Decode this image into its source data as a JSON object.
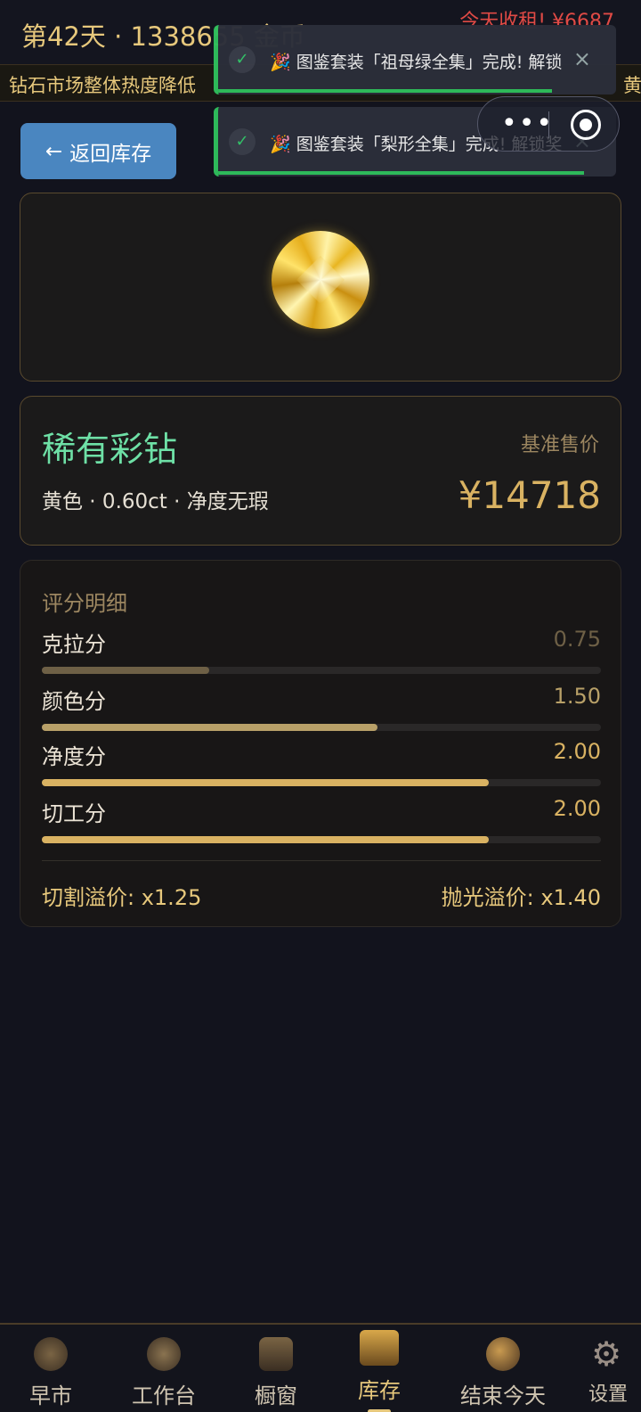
{
  "header": {
    "day_title": "第42天 · 1338655 金币",
    "rent_notice": "今天收租! ¥6687"
  },
  "ticker": {
    "text": "钻石市场整体热度降低",
    "text2": "黄"
  },
  "toasts": [
    {
      "message": "🎉 图鉴套装「祖母绿全集」完成! 解锁",
      "close": "×",
      "progress": 0.84
    },
    {
      "message": "🎉 图鉴套装「梨形全集」完成! 解锁奖",
      "close": "×",
      "progress": 0.92
    }
  ],
  "back_button": {
    "arrow": "←",
    "label": "返回库存"
  },
  "diamond": {
    "type": "稀有彩钻",
    "description": "黄色 · 0.60ct · 净度无瑕",
    "price_label": "基准售价",
    "price": "¥14718"
  },
  "scores": {
    "title": "评分明细",
    "rows": [
      {
        "label": "克拉分",
        "value": "0.75",
        "fraction": 0.3,
        "color": "#6e6046",
        "text_color": "#6e6046"
      },
      {
        "label": "颜色分",
        "value": "1.50",
        "fraction": 0.6,
        "color": "#b8a068",
        "text_color": "#b8a068"
      },
      {
        "label": "净度分",
        "value": "2.00",
        "fraction": 0.8,
        "color": "#d9b262",
        "text_color": "#d9b262"
      },
      {
        "label": "切工分",
        "value": "2.00",
        "fraction": 0.8,
        "color": "#d9b262",
        "text_color": "#d9b262"
      }
    ],
    "cut_premium": "切割溢价: x1.25",
    "polish_premium": "抛光溢价: x1.40"
  },
  "nav": {
    "items": [
      {
        "label": "早市",
        "icon": "market-icon"
      },
      {
        "label": "工作台",
        "icon": "workbench-icon"
      },
      {
        "label": "橱窗",
        "icon": "showcase-icon"
      },
      {
        "label": "库存",
        "icon": "treasure-chest-icon",
        "active": true
      },
      {
        "label": "结束今天",
        "icon": "moon-icon"
      },
      {
        "label": "设置",
        "icon": "gear-icon"
      }
    ]
  }
}
